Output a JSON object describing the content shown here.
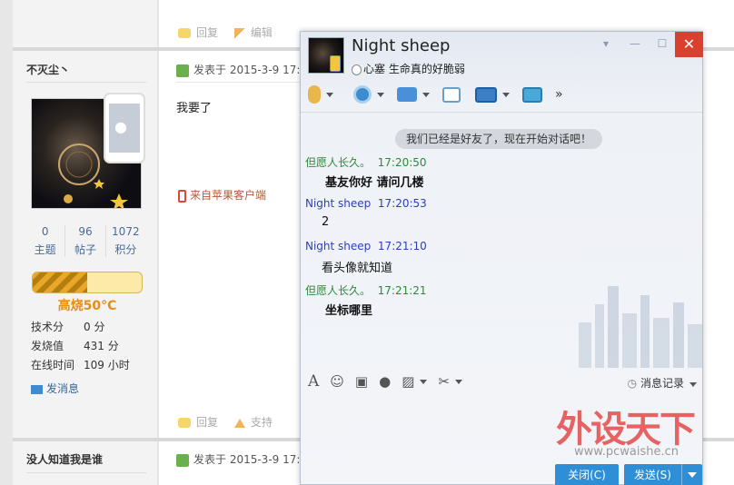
{
  "forum": {
    "post1": {
      "username": "不灭尘丶",
      "stats": [
        {
          "value": "0",
          "label": "主题"
        },
        {
          "value": "96",
          "label": "帖子"
        },
        {
          "value": "1072",
          "label": "积分"
        }
      ],
      "level_progress": 0.5,
      "level_label": "高烧50°C",
      "info": [
        {
          "label": "技术分",
          "value": "0 分"
        },
        {
          "label": "发烧值",
          "value": "431 分"
        },
        {
          "label": "在线时间",
          "value": "109 小时"
        }
      ],
      "send_message": "发消息",
      "posted_prefix": "发表于 2015-3-9 17:",
      "content": "我要了",
      "source": "来自苹果客户端",
      "actions": [
        "回复",
        "支持"
      ]
    },
    "top_actions": [
      "回复",
      "编辑"
    ],
    "post2": {
      "username": "没人知道我是谁",
      "posted_prefix": "发表于 2015-3-9 17:"
    }
  },
  "qq": {
    "title": "Night sheep",
    "signature": "心塞 生命真的好脆弱",
    "system_message": "我们已经是好友了，现在开始对话吧！",
    "messages": [
      {
        "sender": "但愿人长久。",
        "time": "17:20:50",
        "text": "基友你好 请问几楼",
        "who": "a",
        "bold": true
      },
      {
        "sender": "Night sheep",
        "time": "17:20:53",
        "text": "2",
        "who": "b",
        "bold": false
      },
      {
        "sender": "Night sheep",
        "time": "17:21:10",
        "text": "看头像就知道",
        "who": "b",
        "bold": false
      },
      {
        "sender": "但愿人长久。",
        "time": "17:21:21",
        "text": "坐标哪里",
        "who": "a",
        "bold": true
      }
    ],
    "history_label": "消息记录",
    "close_label": "关闭(C)",
    "send_label": "发送(S)"
  },
  "watermark": {
    "brand": "外设天下",
    "url": "www.pcwaishe.cn"
  }
}
